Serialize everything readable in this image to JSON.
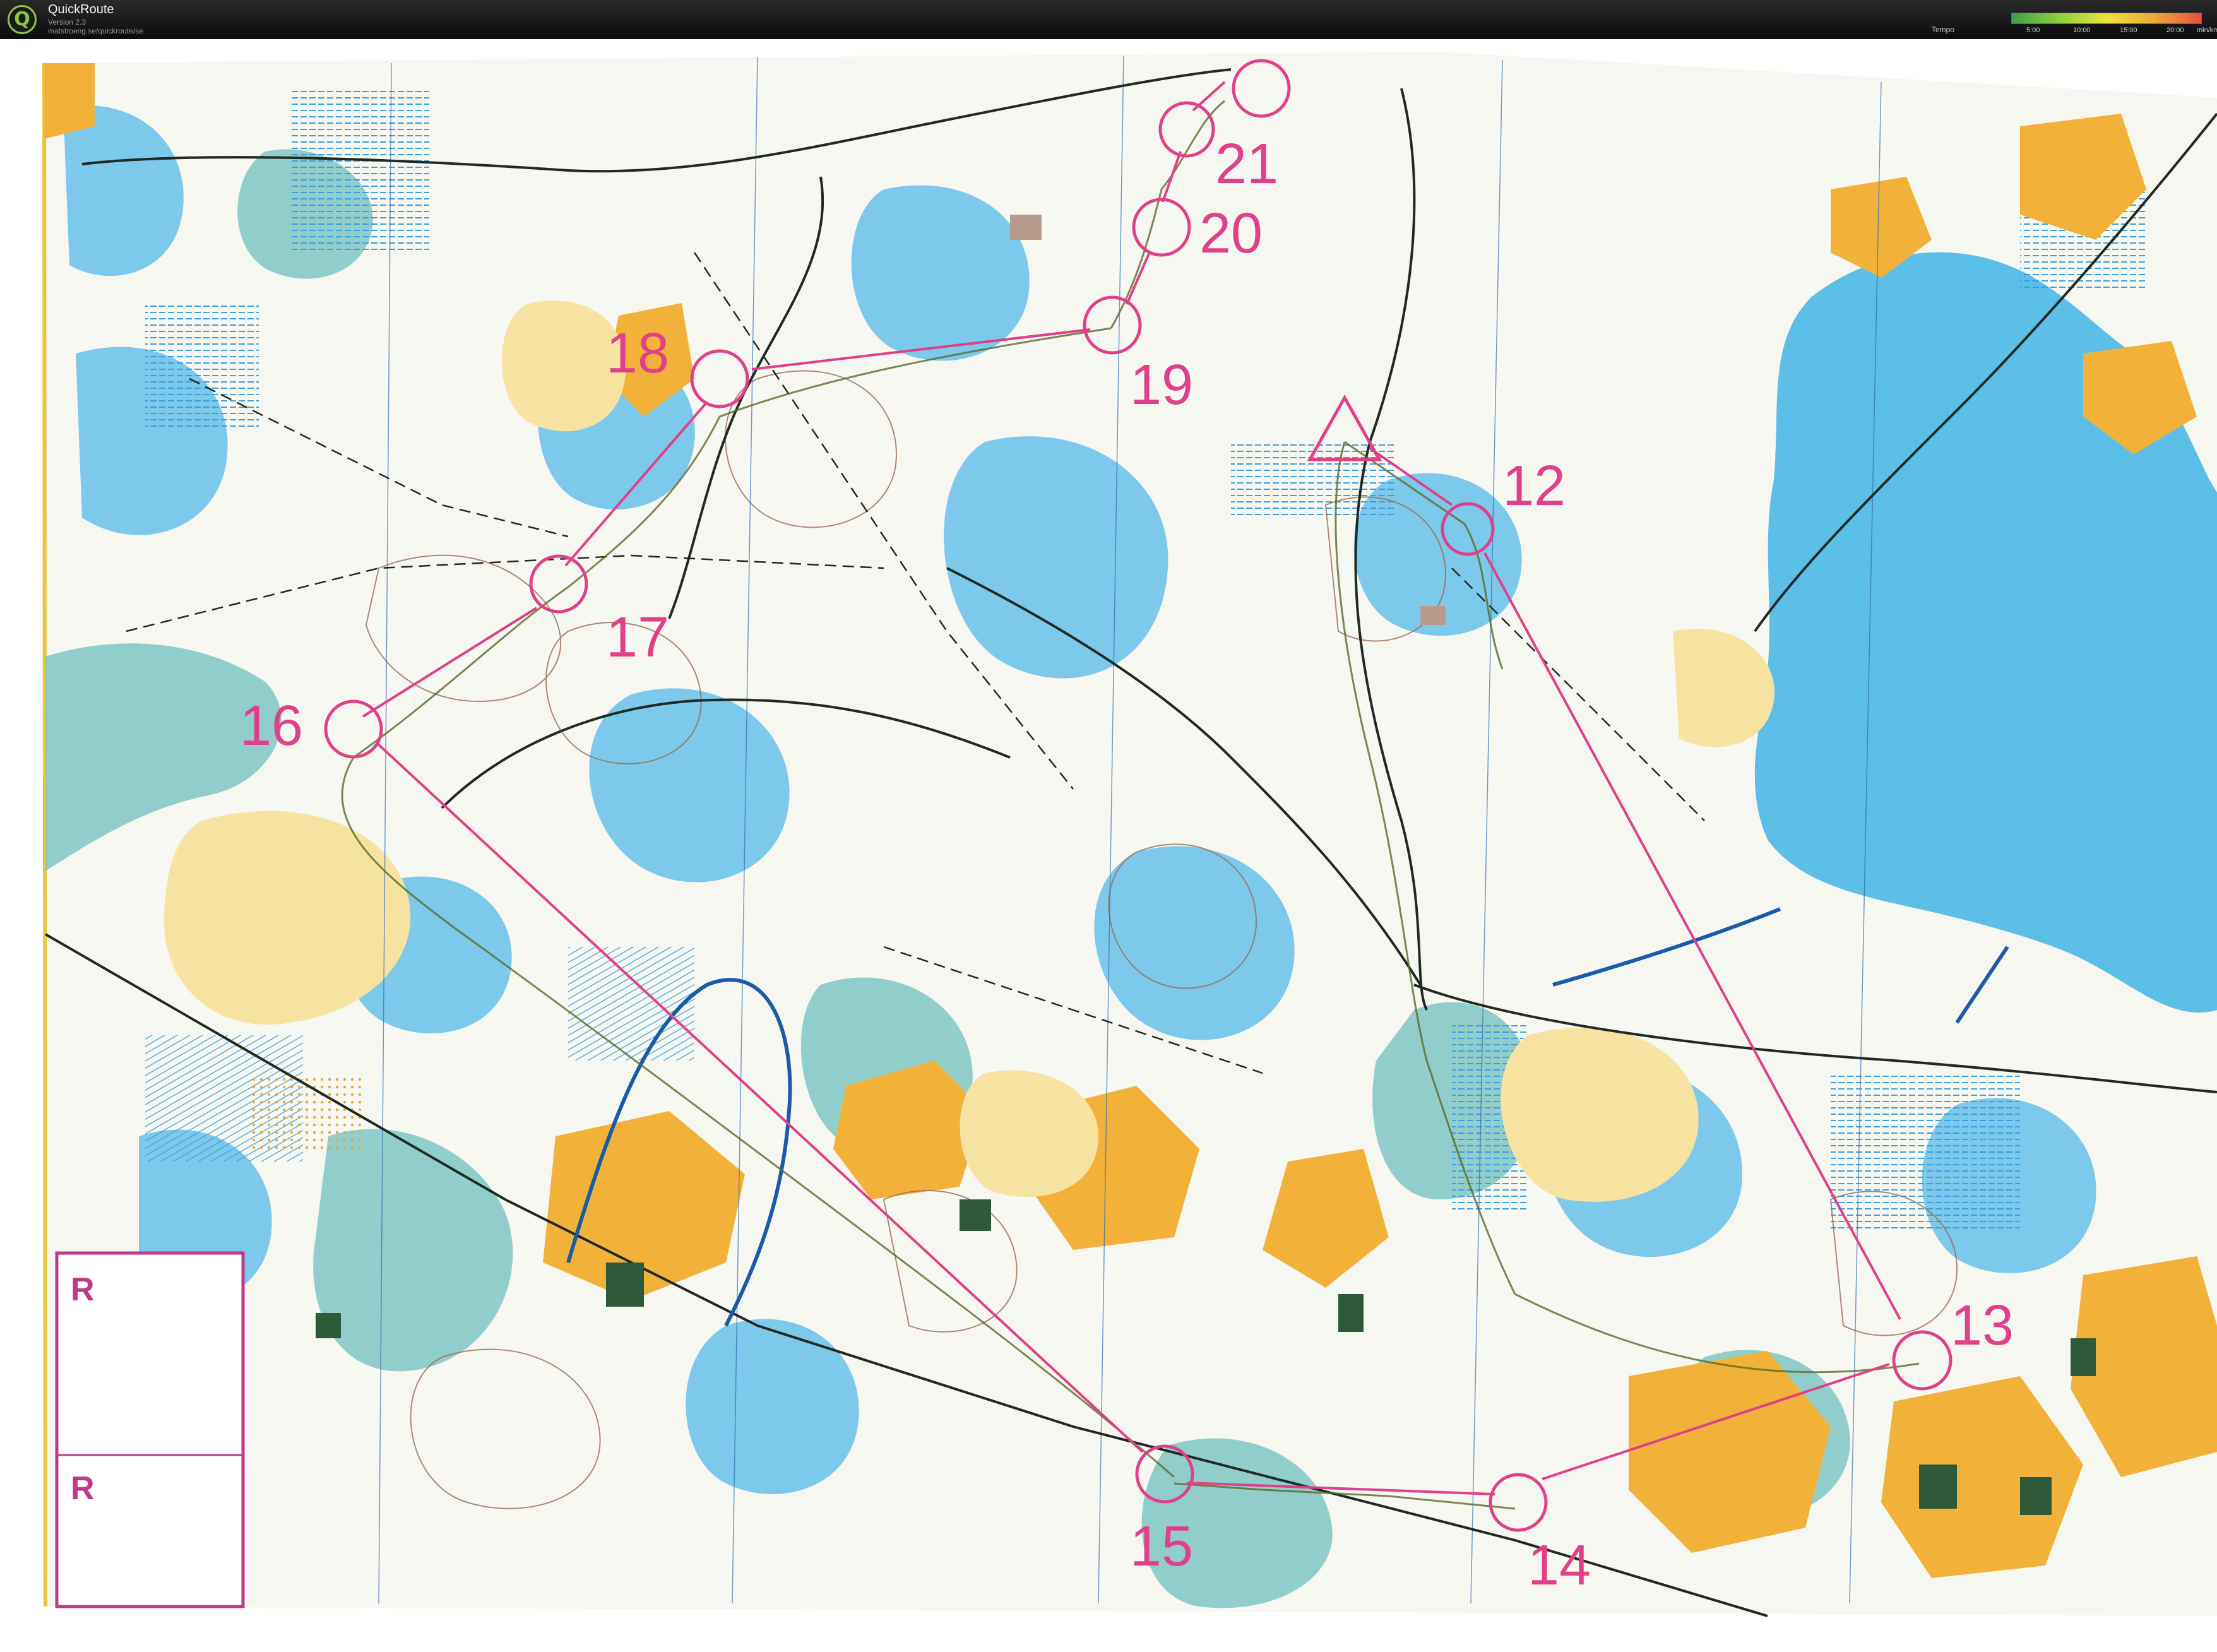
{
  "app": {
    "name": "QuickRoute",
    "version": "Version 2.3",
    "url": "matstroeng.se/quickroute/se"
  },
  "tempo_legend": {
    "label": "Tempo",
    "ticks": [
      "5:00",
      "10:00",
      "15:00",
      "20:00"
    ],
    "unit": "min/km"
  },
  "map": {
    "controls": [
      "12",
      "13",
      "14",
      "15",
      "16",
      "17",
      "18",
      "19",
      "20",
      "21"
    ],
    "box_letters": [
      "R",
      "R"
    ],
    "colors": {
      "course": "#e0408a",
      "water": "#5bbfe8",
      "marsh": "#4aa9e0",
      "open_land": "#f2b23a",
      "rough_open": "#f7e3a1",
      "vegetation": "#7fc7c4",
      "contour": "#9b6b55",
      "track": "#1f2a22",
      "route": "#5a6a2a"
    }
  }
}
